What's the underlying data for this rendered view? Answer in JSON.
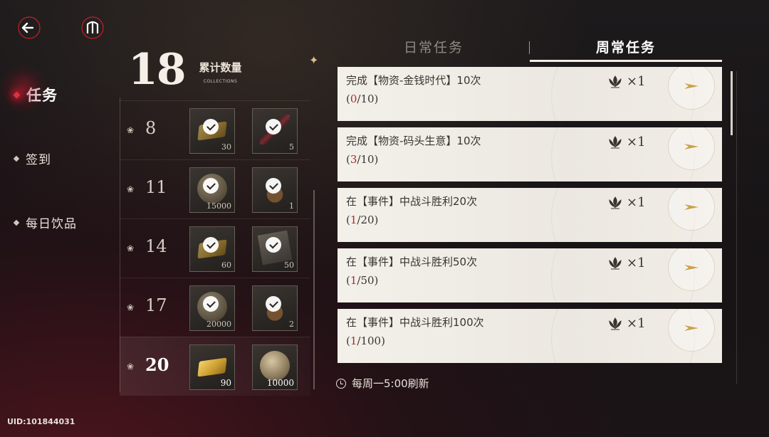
{
  "nav": {
    "items": [
      {
        "label": "任务",
        "active": true
      },
      {
        "label": "签到",
        "active": false
      },
      {
        "label": "每日饮品",
        "active": false
      }
    ]
  },
  "collections": {
    "count": "18",
    "title": "累计数量",
    "subtitle": "COLLECTIONS",
    "rows": [
      {
        "level": "8",
        "items": [
          {
            "qty": "30",
            "claimed": true,
            "icon": "gold-bar-icon"
          },
          {
            "qty": "5",
            "claimed": true,
            "icon": "dagger-icon"
          }
        ]
      },
      {
        "level": "11",
        "items": [
          {
            "qty": "15000",
            "claimed": true,
            "icon": "coin-icon"
          },
          {
            "qty": "1",
            "claimed": true,
            "icon": "potion-icon"
          }
        ]
      },
      {
        "level": "14",
        "items": [
          {
            "qty": "60",
            "claimed": true,
            "icon": "gold-bar-icon"
          },
          {
            "qty": "50",
            "claimed": true,
            "icon": "book-icon"
          }
        ]
      },
      {
        "level": "17",
        "items": [
          {
            "qty": "20000",
            "claimed": true,
            "icon": "coin-icon"
          },
          {
            "qty": "2",
            "claimed": true,
            "icon": "potion-icon"
          }
        ]
      },
      {
        "level": "20",
        "items": [
          {
            "qty": "90",
            "claimed": false,
            "icon": "gold-bar-icon"
          },
          {
            "qty": "10000",
            "claimed": false,
            "icon": "coin-icon"
          }
        ]
      }
    ]
  },
  "tabs": [
    {
      "label": "日常任务",
      "active": false
    },
    {
      "label": "周常任务",
      "active": true
    }
  ],
  "tasks": [
    {
      "desc": "完成【物资-金钱时代】10次",
      "current": "0",
      "total": "/10)",
      "open": "(",
      "reward": "×1"
    },
    {
      "desc": "完成【物资-码头生意】10次",
      "current": "3",
      "total": "/10)",
      "open": "(",
      "reward": "×1"
    },
    {
      "desc": "在【事件】中战斗胜利20次",
      "current": "1",
      "total": "/20)",
      "open": "(",
      "reward": "×1"
    },
    {
      "desc": "在【事件】中战斗胜利50次",
      "current": "1",
      "total": "/50)",
      "open": "(",
      "reward": "×1"
    },
    {
      "desc": "在【事件】中战斗胜利100次",
      "current": "1",
      "total": "/100)",
      "open": "(",
      "reward": "×1"
    }
  ],
  "refresh_text": "每周一5:00刷新",
  "uid": "UID:101844031",
  "colors": {
    "accent_red": "#b0282c",
    "gold": "#c9a34a"
  }
}
